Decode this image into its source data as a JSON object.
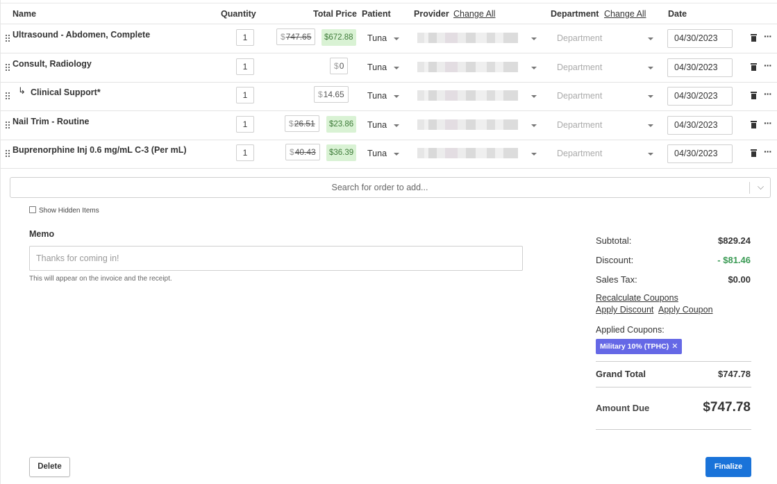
{
  "header": {
    "name": "Name",
    "quantity": "Quantity",
    "total_price": "Total Price",
    "patient": "Patient",
    "provider": "Provider",
    "provider_change_all": "Change All",
    "department": "Department",
    "department_change_all": "Change All",
    "date": "Date"
  },
  "rows": [
    {
      "name": "Ultrasound - Abdomen, Complete",
      "qty": "1",
      "currency": "$",
      "price": "747.65",
      "discounted": "$672.88",
      "patient": "Tuna",
      "department_placeholder": "Department",
      "date": "04/30/2023"
    },
    {
      "name": "Consult, Radiology",
      "qty": "1",
      "currency": "$",
      "price": "0",
      "patient": "Tuna",
      "department_placeholder": "Department",
      "date": "04/30/2023"
    },
    {
      "name": "Clinical Support*",
      "qty": "1",
      "currency": "$",
      "price": "14.65",
      "patient": "Tuna",
      "department_placeholder": "Department",
      "date": "04/30/2023",
      "sub_arrow": "↳"
    },
    {
      "name": "Nail Trim - Routine",
      "qty": "1",
      "currency": "$",
      "price": "26.51",
      "discounted": "$23.86",
      "patient": "Tuna",
      "department_placeholder": "Department",
      "date": "04/30/2023"
    },
    {
      "name": "Buprenorphine Inj 0.6 mg/mL C-3 (Per mL)",
      "qty": "1",
      "currency": "$",
      "price": "40.43",
      "discounted": "$36.39",
      "patient": "Tuna",
      "department_placeholder": "Department",
      "date": "04/30/2023"
    }
  ],
  "row_actions": {
    "more": "···"
  },
  "search": {
    "placeholder": "Search for order to add..."
  },
  "show_hidden": {
    "label": "Show Hidden Items",
    "checked": false
  },
  "memo": {
    "label": "Memo",
    "placeholder": "Thanks for coming in!",
    "value": "",
    "help": "This will appear on the invoice and the receipt."
  },
  "totals": {
    "subtotal_label": "Subtotal:",
    "subtotal": "$829.24",
    "discount_label": "Discount:",
    "discount": "- $81.46",
    "sales_tax_label": "Sales Tax:",
    "sales_tax": "$0.00",
    "recalculate": "Recalculate Coupons",
    "apply_discount": "Apply Discount",
    "apply_coupon": "Apply Coupon",
    "applied_coupons_label": "Applied Coupons:",
    "coupon": "Military 10% (TPHC)",
    "coupon_remove": "✕",
    "grand_total_label": "Grand Total",
    "grand_total": "$747.78",
    "amount_due_label": "Amount Due",
    "amount_due": "$747.78"
  },
  "buttons": {
    "delete": "Delete",
    "finalize": "Finalize"
  },
  "colors": {
    "coupon_bg": "#6568e6",
    "discount_green": "#3a9a54",
    "finalize_blue": "#1a73d9",
    "price_discount_bg": "#d9f2d4"
  }
}
